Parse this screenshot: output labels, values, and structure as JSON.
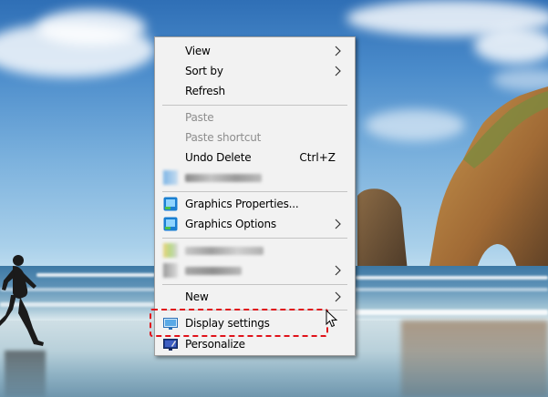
{
  "context_menu": {
    "view": {
      "label": "View"
    },
    "sort_by": {
      "label": "Sort by"
    },
    "refresh": {
      "label": "Refresh"
    },
    "paste": {
      "label": "Paste"
    },
    "paste_shortcut": {
      "label": "Paste shortcut"
    },
    "undo_delete": {
      "label": "Undo Delete",
      "shortcut": "Ctrl+Z"
    },
    "graphics_properties": {
      "label": "Graphics Properties..."
    },
    "graphics_options": {
      "label": "Graphics Options"
    },
    "new": {
      "label": "New"
    },
    "display_settings": {
      "label": "Display settings"
    },
    "personalize": {
      "label": "Personalize"
    }
  },
  "highlight_color": "#e0131a",
  "menu_background": "#f2f2f2",
  "disabled_text_color": "#8d8d8d",
  "icons": {
    "submenu_arrow": "chevron-right-icon",
    "graphics": "intel-graphics-icon",
    "display": "display-icon",
    "personalize": "personalize-icon",
    "cursor": "mouse-pointer-icon"
  }
}
